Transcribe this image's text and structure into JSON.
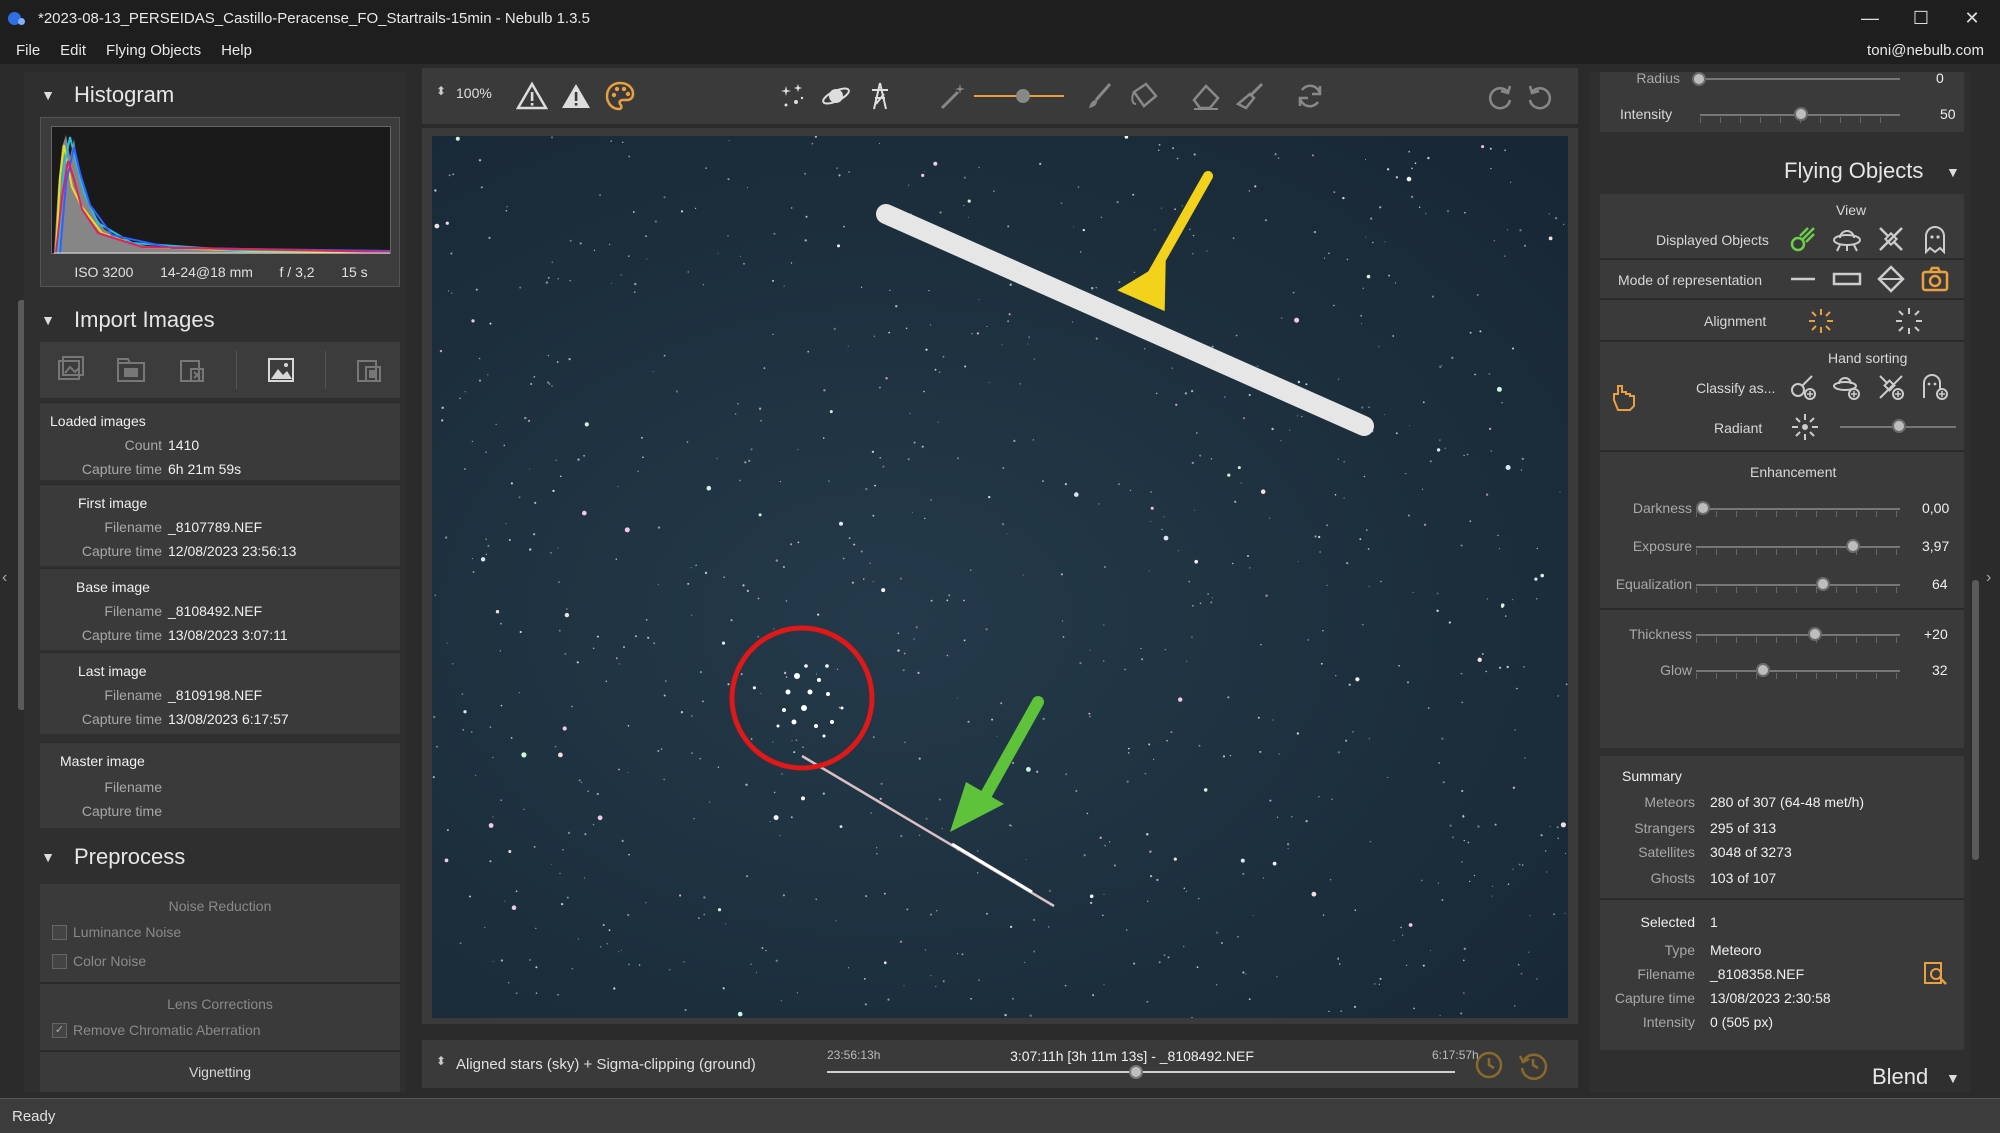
{
  "window": {
    "title": "*2023-08-13_PERSEIDAS_Castillo-Peracense_FO_Startrails-15min - Nebulb 1.3.5",
    "minimize": "—",
    "maximize": "☐",
    "close": "✕"
  },
  "menu": {
    "items": [
      "File",
      "Edit",
      "Flying Objects",
      "Help"
    ],
    "user": "toni@nebulb.com"
  },
  "left": {
    "histogram": {
      "title": "Histogram",
      "iso": "ISO 3200",
      "lens": "14-24@18 mm",
      "aperture": "f / 3,2",
      "exposure": "15 s"
    },
    "import": {
      "title": "Import Images",
      "loaded": {
        "title": "Loaded images",
        "count_label": "Count",
        "count": "1410",
        "capture_label": "Capture time",
        "capture": "6h 21m 59s"
      },
      "first": {
        "title": "First image",
        "filename_label": "Filename",
        "filename": "_8107789.NEF",
        "capture_label": "Capture time",
        "capture": "12/08/2023 23:56:13"
      },
      "base": {
        "title": "Base image",
        "filename_label": "Filename",
        "filename": "_8108492.NEF",
        "capture_label": "Capture time",
        "capture": "13/08/2023 3:07:11"
      },
      "last": {
        "title": "Last image",
        "filename_label": "Filename",
        "filename": "_8109198.NEF",
        "capture_label": "Capture time",
        "capture": "13/08/2023 6:17:57"
      },
      "master": {
        "title": "Master image",
        "filename_label": "Filename",
        "capture_label": "Capture time"
      }
    },
    "preprocess": {
      "title": "Preprocess",
      "noise_title": "Noise Reduction",
      "luminance": "Luminance Noise",
      "color": "Color Noise",
      "lens_title": "Lens Corrections",
      "chromatic": "Remove Chromatic Aberration",
      "vignetting": "Vignetting"
    }
  },
  "toolbar": {
    "zoom": "100%"
  },
  "bottom": {
    "mode": "Aligned stars (sky) + Sigma-clipping (ground)",
    "start": "23:56:13h",
    "current": "3:07:11h [3h 11m 13s] - _8108492.NEF",
    "end": "6:17:57h",
    "position": 0.495
  },
  "right": {
    "top": {
      "radius_label": "Radius",
      "radius_value": "0",
      "intensity_label": "Intensity",
      "intensity_value": "50"
    },
    "flying_objects": {
      "title": "Flying Objects",
      "view_title": "View",
      "displayed_label": "Displayed Objects",
      "mode_label": "Mode of representation",
      "alignment_label": "Alignment",
      "hand_title": "Hand sorting",
      "classify_label": "Classify as...",
      "radiant_label": "Radiant",
      "enh_title": "Enhancement",
      "darkness_label": "Darkness",
      "darkness_value": "0,00",
      "exposure_label": "Exposure",
      "exposure_value": "3,97",
      "equalization_label": "Equalization",
      "equalization_value": "64",
      "thickness_label": "Thickness",
      "thickness_value": "+20",
      "glow_label": "Glow",
      "glow_value": "32"
    },
    "summary": {
      "title": "Summary",
      "meteors_label": "Meteors",
      "meteors": "280 of 307 (64-48 met/h)",
      "strangers_label": "Strangers",
      "strangers": "295 of 313",
      "satellites_label": "Satellites",
      "satellites": "3048 of 3273",
      "ghosts_label": "Ghosts",
      "ghosts": "103 of 107"
    },
    "selected": {
      "title": "Selected",
      "count": "1",
      "type_label": "Type",
      "type": "Meteoro",
      "filename_label": "Filename",
      "filename": "_8108358.NEF",
      "capture_label": "Capture time",
      "capture": "13/08/2023 2:30:58",
      "intensity_label": "Intensity",
      "intensity": "0 (505 px)"
    },
    "blend_title": "Blend"
  },
  "status": "Ready",
  "colors": {
    "accent_orange": "#e8a040",
    "accent_green": "#6ccf4a",
    "annotation_yellow": "#f2d21a",
    "annotation_green": "#5ec23a",
    "annotation_red": "#e01818"
  }
}
